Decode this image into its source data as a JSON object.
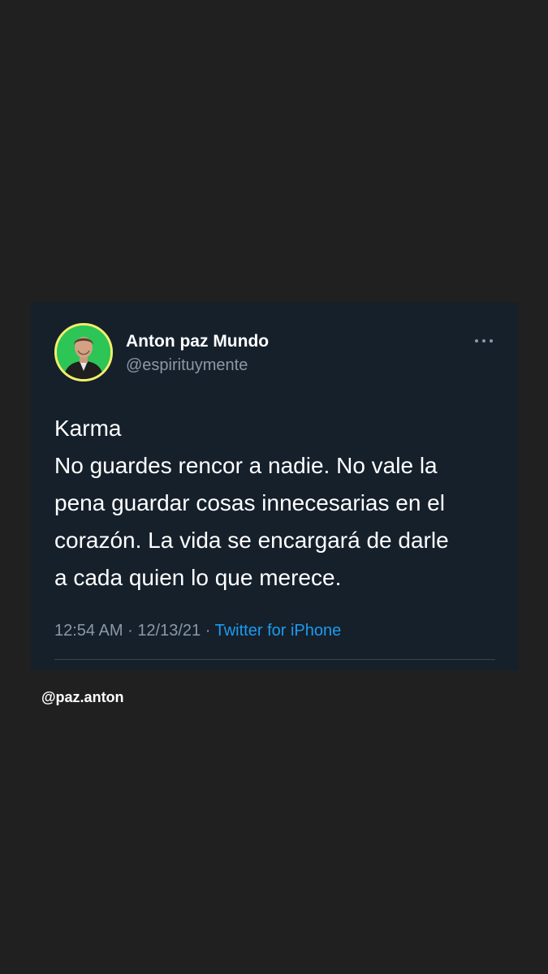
{
  "tweet": {
    "display_name": "Anton paz Mundo",
    "handle": "@espirituymente",
    "more_icon": "more-horizontal-icon",
    "text_lines": [
      "Karma",
      "No guardes rencor a nadie. No vale la",
      "pena guardar cosas innecesarias en el",
      "corazón. La vida se encargará de darle",
      "a cada quien lo que merece."
    ],
    "time": "12:54 AM",
    "separator": "·",
    "date": "12/13/21",
    "source": "Twitter for iPhone"
  },
  "watermark": "@paz.anton",
  "colors": {
    "page_background": "#202020",
    "card_background": "#15202b",
    "secondary_text": "#8b98a5",
    "link": "#1d9bf0",
    "avatar_background": "#2cc556",
    "avatar_ring": "#f4ee6a"
  }
}
